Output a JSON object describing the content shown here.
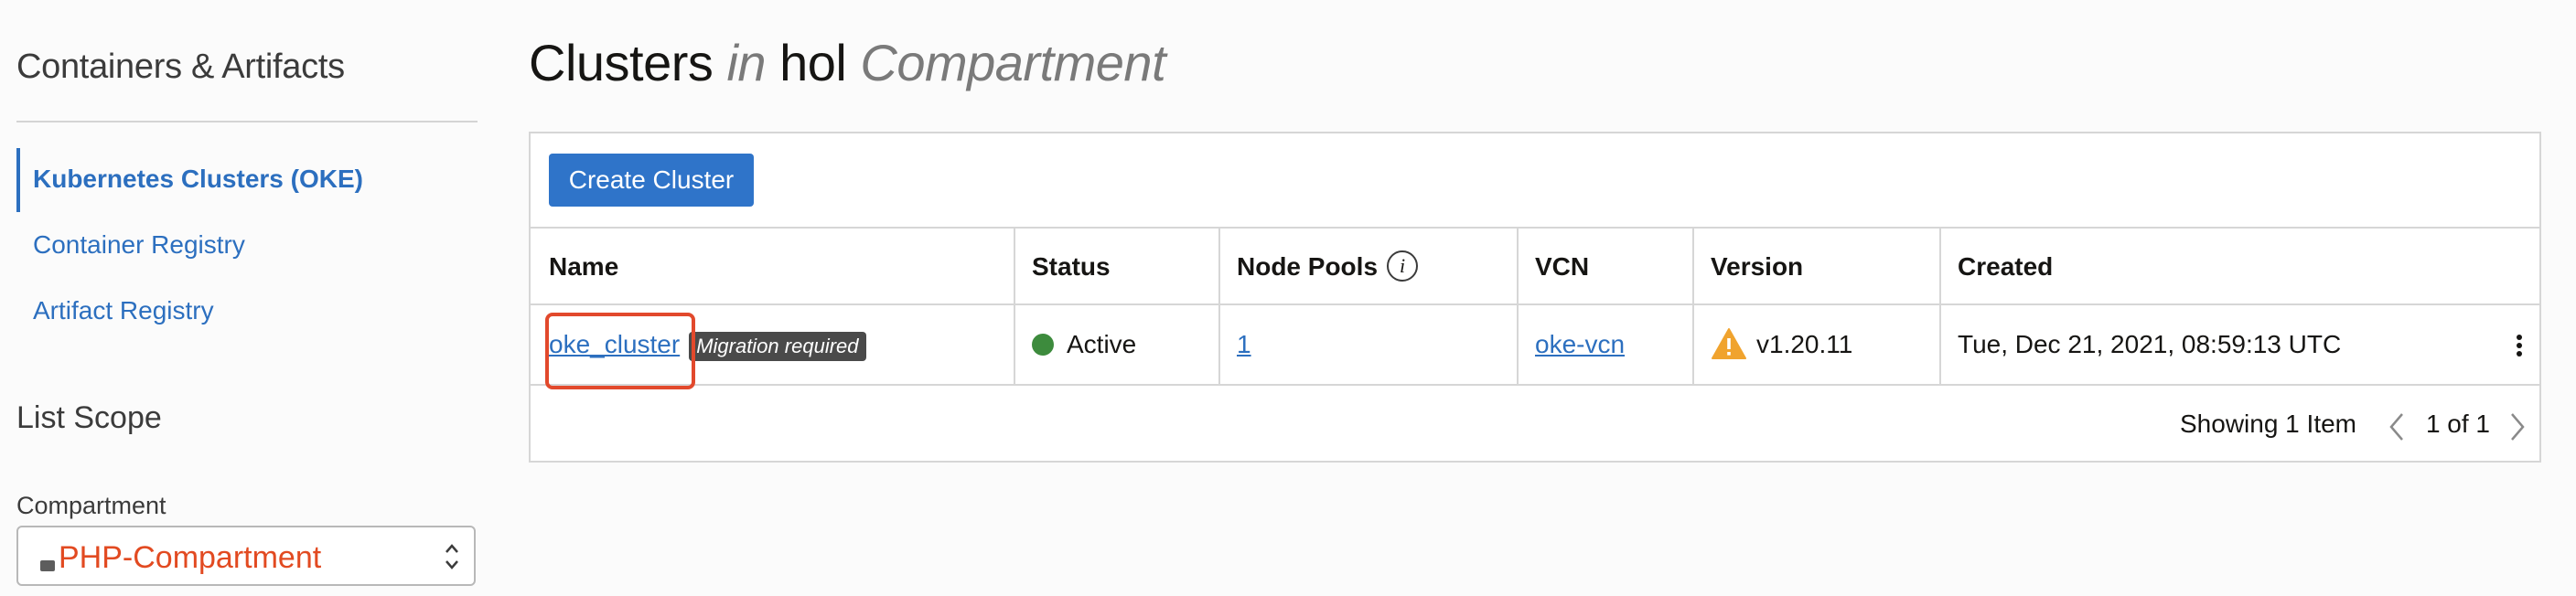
{
  "sidebar": {
    "title": "Containers & Artifacts",
    "nav": [
      {
        "label": "Kubernetes Clusters (OKE)",
        "active": true
      },
      {
        "label": "Container Registry",
        "active": false
      },
      {
        "label": "Artifact Registry",
        "active": false
      }
    ],
    "list_scope_title": "List Scope",
    "compartment_label": "Compartment",
    "compartment_value": "PHP-Compartment"
  },
  "header": {
    "title_main": "Clusters",
    "title_in": "in",
    "title_compartment": "hol",
    "title_suffix": "Compartment"
  },
  "toolbar": {
    "create_label": "Create Cluster"
  },
  "table": {
    "columns": [
      "Name",
      "Status",
      "Node Pools",
      "VCN",
      "Version",
      "Created"
    ],
    "rows": [
      {
        "name": "oke_cluster",
        "badge": "Migration required",
        "status": "Active",
        "node_pools": "1",
        "vcn": "oke-vcn",
        "version": "v1.20.11",
        "created": "Tue, Dec 21, 2021, 08:59:13 UTC"
      }
    ]
  },
  "footer": {
    "showing": "Showing 1 Item",
    "page": "1 of 1"
  },
  "colors": {
    "accent": "#2f74c9",
    "link": "#2c6fbf",
    "status_active": "#3d8b3d",
    "warning": "#f0a32e",
    "highlight": "#e2492c",
    "compartment_value": "#e24a21"
  },
  "icons": {
    "info": "info-icon",
    "warning": "warning-icon",
    "kebab": "kebab-menu-icon",
    "select": "chevron-updown-icon",
    "prev": "chevron-left-icon",
    "next": "chevron-right-icon"
  }
}
